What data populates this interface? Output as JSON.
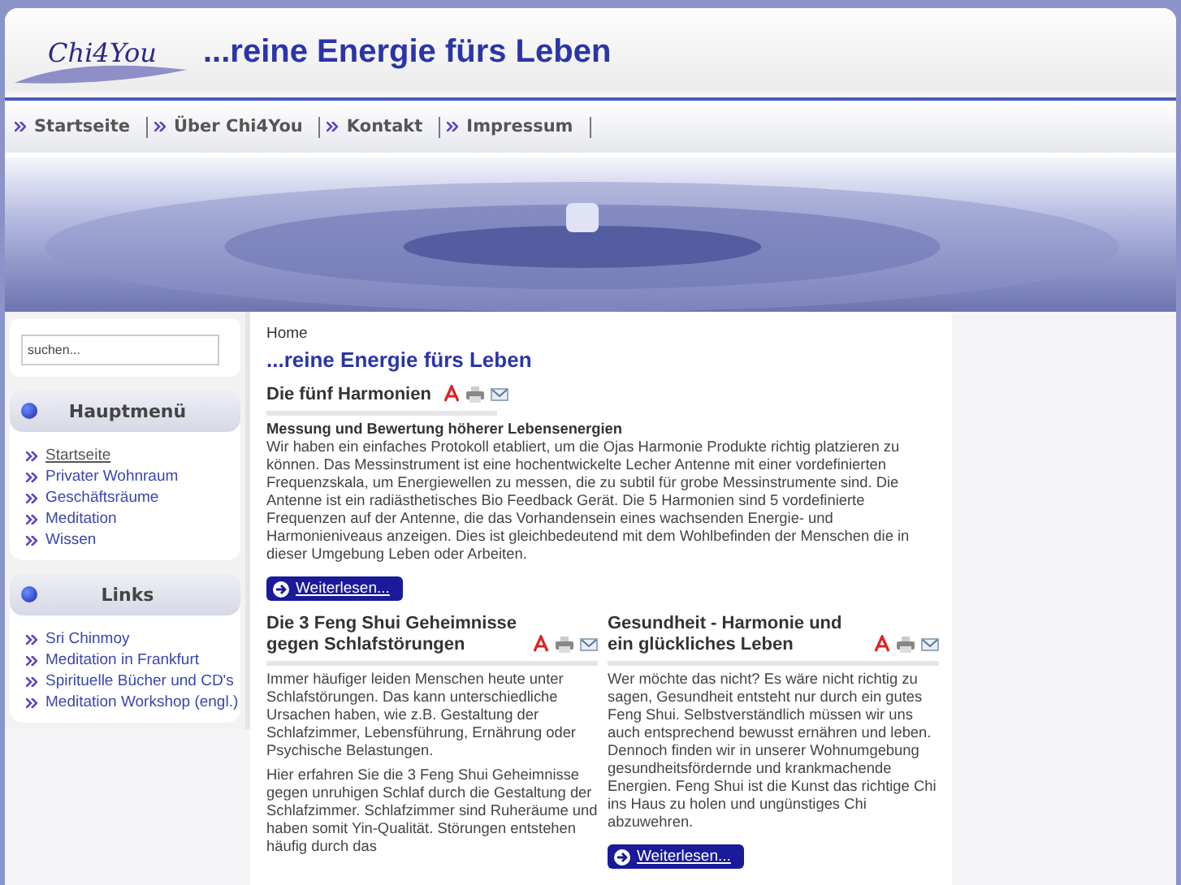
{
  "header": {
    "logo": "Chi4You",
    "slogan": "...reine Energie fürs Leben"
  },
  "nav": [
    {
      "label": "Startseite"
    },
    {
      "label": "Über Chi4You"
    },
    {
      "label": "Kontakt"
    },
    {
      "label": "Impressum"
    }
  ],
  "search": {
    "placeholder": "suchen..."
  },
  "modules": [
    {
      "title": "Hauptmenü",
      "items": [
        {
          "label": "Startseite",
          "selected": true
        },
        {
          "label": "Privater Wohnraum",
          "selected": false
        },
        {
          "label": "Geschäftsräume",
          "selected": false
        },
        {
          "label": "Meditation",
          "selected": false
        },
        {
          "label": "Wissen",
          "selected": false
        }
      ]
    },
    {
      "title": "Links",
      "items": [
        {
          "label": "Sri Chinmoy",
          "selected": false
        },
        {
          "label": "Meditation in Frankfurt",
          "selected": false
        },
        {
          "label": "Spirituelle Bücher und CD's",
          "selected": false
        },
        {
          "label": "Meditation Workshop (engl.)",
          "selected": false
        }
      ]
    }
  ],
  "breadcrumb": "Home",
  "page_title": "...reine Energie fürs Leben",
  "featured": {
    "title": "Die fünf Harmonien",
    "subtitle": "Messung und Bewertung höherer Lebensenergien",
    "body": "Wir haben ein einfaches Protokoll etabliert, um die Ojas Harmonie Produkte richtig platzieren zu können. Das Messinstrument ist eine hochentwickelte Lecher Antenne mit einer vordefinierten Frequenzskala, um Energiewellen zu messen, die zu subtil für grobe Messinstrumente sind. Die Antenne ist ein radiästhetisches Bio Feedback Gerät. Die 5 Harmonien sind 5 vordefinierte Frequenzen auf der Antenne, die das Vorhandensein eines wachsenden Energie- und Harmonieniveaus anzeigen. Dies ist gleichbedeutend mit dem Wohlbefinden der Menschen die in dieser Umgebung Leben oder Arbeiten.",
    "button": "Weiterlesen..."
  },
  "articles": [
    {
      "title": "Die 3 Feng Shui Geheimnisse gegen Schlafstörungen",
      "paragraphs": [
        "Immer häufiger leiden Menschen heute unter Schlafstörungen. Das kann unterschiedliche Ursachen haben, wie z.B. Gestaltung der Schlafzimmer, Lebensführung, Ernährung oder Psychische Belastungen.",
        "Hier erfahren Sie die 3 Feng Shui Geheimnisse gegen unruhigen Schlaf durch die Gestaltung der Schlafzimmer. Schlafzimmer sind Ruheräume und haben somit Yin-Qualität. Störungen entstehen häufig durch das"
      ]
    },
    {
      "title": "Gesundheit - Harmonie und ein glückliches Leben",
      "paragraphs": [
        "Wer möchte das nicht? Es wäre nicht richtig zu sagen, Gesundheit entsteht nur durch ein gutes Feng Shui. Selbstverständlich müssen wir uns auch entsprechend bewusst ernähren und leben. Dennoch finden wir in unserer Wohnumgebung gesundheitsfördernde und krankmachende Energien. Feng Shui ist die Kunst das richtige Chi ins Haus zu holen und ungünstiges Chi abzuwehren."
      ],
      "button": "Weiterlesen..."
    }
  ]
}
